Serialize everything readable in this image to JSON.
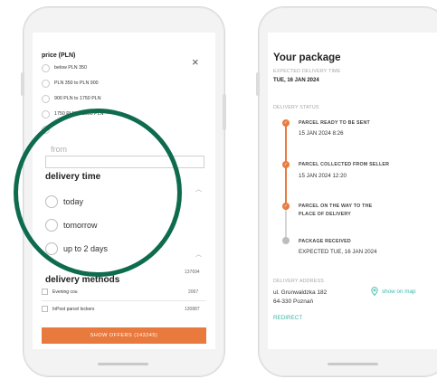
{
  "filters": {
    "price_title": "price (PLN)",
    "price_options": [
      "below PLN 350",
      "PLN 350 to PLN 900",
      "900 PLN to 1750 PLN",
      "1750 PLN to 2500 PLN"
    ],
    "from_label": "from",
    "delivery_time_title": "delivery time",
    "delivery_time_options": [
      "today",
      "tomorrow",
      "up to 2 days"
    ],
    "delivery_methods_title": "delivery methods",
    "delivery_methods": [
      {
        "label": "Evening cou",
        "count": "2067"
      },
      {
        "label": "InPost parcel lockers",
        "count": "130887"
      }
    ],
    "dm_header_count": "137694",
    "show_offers_label": "SHOW OFFERS (143245)"
  },
  "package": {
    "title": "Your package",
    "expected_label": "EXPECTED DELIVERY TIME",
    "expected_value": "TUE, 16 JAN 2024",
    "status_label": "DELIVERY STATUS",
    "steps": [
      {
        "title": "PARCEL READY TO BE SENT",
        "sub": "15 JAN 2024 8:26"
      },
      {
        "title": "PARCEL COLLECTED FROM SELLER",
        "sub": "15 JAN 2024 12:20"
      },
      {
        "title": "PARCEL ON THE WAY TO THE",
        "title2": "PLACE OF DELIVERY",
        "sub": ""
      },
      {
        "title": "PACKAGE RECEIVED",
        "sub": "EXPECTED TUE, 16 JAN 2024"
      }
    ],
    "address_label": "DELIVERY ADDRESS",
    "address_line1": "ul. Grunwaldzka 182",
    "address_line2": "64-330 Poznań",
    "show_on_map": "show on map",
    "redirect": "REDIRECT"
  },
  "colors": {
    "accent": "#e97a3e",
    "highlight": "#0e6b4e",
    "link": "#3cb6a8"
  },
  "icons": [
    "close-icon",
    "check-icon",
    "map-pin-icon",
    "chevron-up-icon"
  ]
}
